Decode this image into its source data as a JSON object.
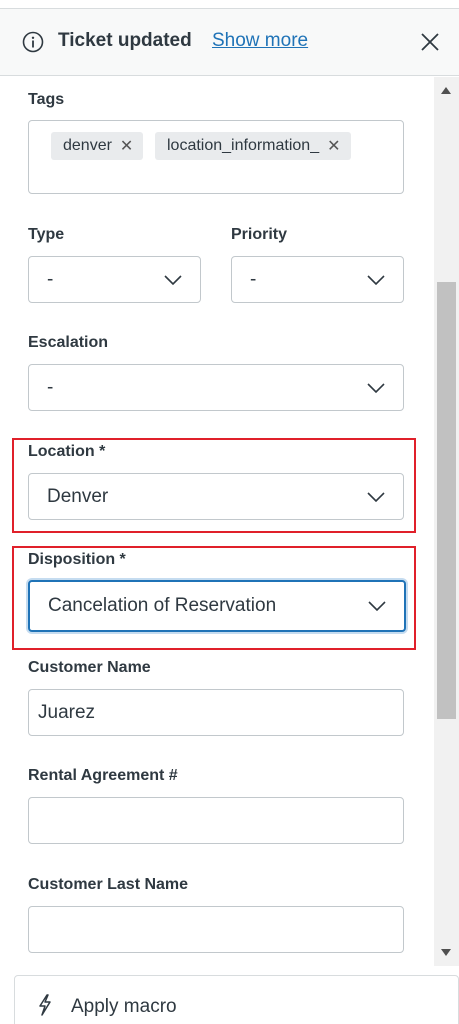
{
  "banner": {
    "icon": "info-icon",
    "title": "Ticket updated",
    "link": "Show more",
    "close_icon": "close-icon"
  },
  "fields": {
    "tags": {
      "label": "Tags",
      "items": [
        "denver",
        "location_information_"
      ],
      "remove_glyph": "✕"
    },
    "type": {
      "label": "Type",
      "value": "-"
    },
    "priority": {
      "label": "Priority",
      "value": "-"
    },
    "escalation": {
      "label": "Escalation",
      "value": "-"
    },
    "location": {
      "label": "Location *",
      "value": "Denver"
    },
    "disposition": {
      "label": "Disposition *",
      "value": "Cancelation of Reservation"
    },
    "customer_name": {
      "label": "Customer Name",
      "value": "Juarez"
    },
    "rental_agreement": {
      "label": "Rental Agreement #",
      "value": ""
    },
    "customer_last_name": {
      "label": "Customer Last Name",
      "value": ""
    }
  },
  "footer": {
    "icon": "lightning-bolt-icon",
    "label": "Apply macro"
  },
  "colors": {
    "highlight": "#e0202a",
    "link": "#1f73b7",
    "focus": "#1f73b7"
  }
}
